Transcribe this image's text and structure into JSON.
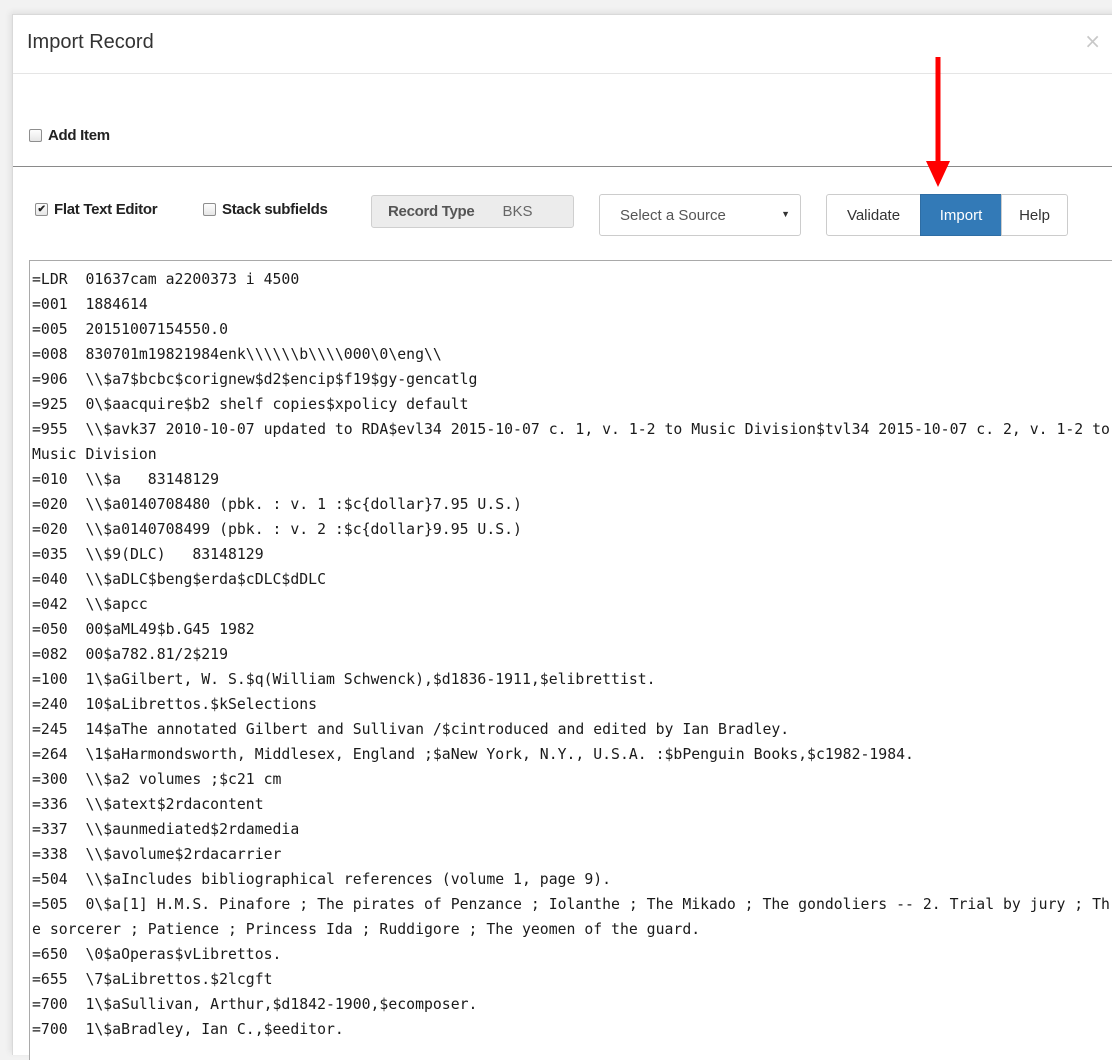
{
  "dialog": {
    "title": "Import Record",
    "close_glyph": "×"
  },
  "options": {
    "add_item": {
      "label": "Add Item",
      "checked": false
    },
    "flat_text_editor": {
      "label": "Flat Text Editor",
      "checked": true
    },
    "stack_subfields": {
      "label": "Stack subfields",
      "checked": false
    }
  },
  "record_type": {
    "label": "Record Type",
    "value": "BKS"
  },
  "source_select": {
    "selected": "Select a Source"
  },
  "buttons": {
    "validate": "Validate",
    "import": "Import",
    "help": "Help"
  },
  "annotation": {
    "arrow_color": "#ff0000",
    "points_to": "import-button"
  },
  "colors": {
    "primary": "#337ab7"
  },
  "icons": {
    "close": "close-icon",
    "caret": "caret-down-icon",
    "check": "checkmark-icon"
  },
  "editor": {
    "text": "=LDR  01637cam a2200373 i 4500\n=001  1884614\n=005  20151007154550.0\n=008  830701m19821984enk\\\\\\\\\\\\b\\\\\\\\000\\0\\eng\\\\\n=906  \\\\$a7$bcbc$corignew$d2$encip$f19$gy-gencatlg\n=925  0\\$aacquire$b2 shelf copies$xpolicy default\n=955  \\\\$avk37 2010-10-07 updated to RDA$evl34 2015-10-07 c. 1, v. 1-2 to Music Division$tvl34 2015-10-07 c. 2, v. 1-2 to Music Division\n=010  \\\\$a   83148129\n=020  \\\\$a0140708480 (pbk. : v. 1 :$c{dollar}7.95 U.S.)\n=020  \\\\$a0140708499 (pbk. : v. 2 :$c{dollar}9.95 U.S.)\n=035  \\\\$9(DLC)   83148129\n=040  \\\\$aDLC$beng$erda$cDLC$dDLC\n=042  \\\\$apcc\n=050  00$aML49$b.G45 1982\n=082  00$a782.81/2$219\n=100  1\\$aGilbert, W. S.$q(William Schwenck),$d1836-1911,$elibrettist.\n=240  10$aLibrettos.$kSelections\n=245  14$aThe annotated Gilbert and Sullivan /$cintroduced and edited by Ian Bradley.\n=264  \\1$aHarmondsworth, Middlesex, England ;$aNew York, N.Y., U.S.A. :$bPenguin Books,$c1982-1984.\n=300  \\\\$a2 volumes ;$c21 cm\n=336  \\\\$atext$2rdacontent\n=337  \\\\$aunmediated$2rdamedia\n=338  \\\\$avolume$2rdacarrier\n=504  \\\\$aIncludes bibliographical references (volume 1, page 9).\n=505  0\\$a[1] H.M.S. Pinafore ; The pirates of Penzance ; Iolanthe ; The Mikado ; The gondoliers -- 2. Trial by jury ; The sorcerer ; Patience ; Princess Ida ; Ruddigore ; The yeomen of the guard.\n=650  \\0$aOperas$vLibrettos.\n=655  \\7$aLibrettos.$2lcgft\n=700  1\\$aSullivan, Arthur,$d1842-1900,$ecomposer.\n=700  1\\$aBradley, Ian C.,$eeditor."
  }
}
